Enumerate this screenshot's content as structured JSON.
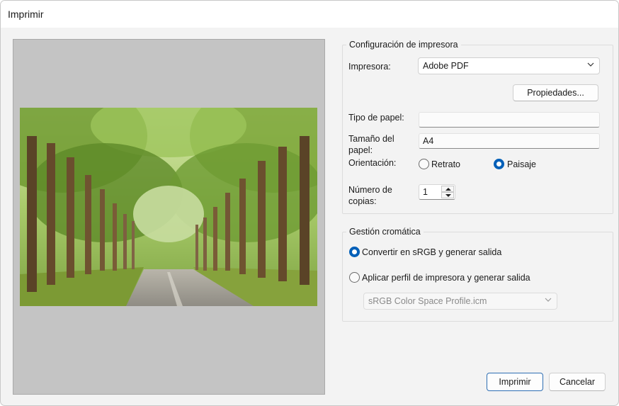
{
  "window": {
    "title": "Imprimir"
  },
  "preview": {
    "image_alt": "tree-lined road photo"
  },
  "printer_config": {
    "title": "Configuración de impresora",
    "printer_label": "Impresora:",
    "printer_value": "Adobe PDF",
    "properties_button": "Propiedades...",
    "paper_type_label": "Tipo de papel:",
    "paper_type_value": "",
    "paper_size_label_line1": "Tamaño del",
    "paper_size_label_line2": "papel:",
    "paper_size_value": "A4",
    "orientation_label": "Orientación:",
    "orientation_portrait": "Retrato",
    "orientation_landscape": "Paisaje",
    "orientation_selected": "Paisaje",
    "copies_label_line1": "Número de",
    "copies_label_line2": "copias:",
    "copies_value": "1"
  },
  "color_management": {
    "title": "Gestión cromática",
    "option_srgb": "Convertir en sRGB y generar salida",
    "option_profile": "Aplicar perfil de impresora y generar salida",
    "selected": "option_srgb",
    "profile_value": "sRGB Color Space Profile.icm"
  },
  "footer": {
    "print_button": "Imprimir",
    "cancel_button": "Cancelar"
  },
  "colors": {
    "accent": "#005fb8",
    "dialog_bg": "#f3f3f3",
    "preview_bg": "#c4c4c4"
  }
}
